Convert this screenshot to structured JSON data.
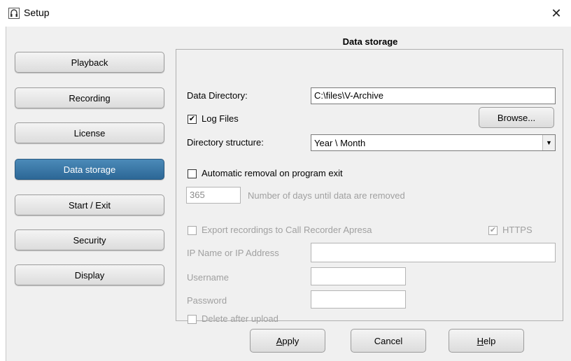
{
  "window": {
    "title": "Setup",
    "close_glyph": "✕"
  },
  "section_title": "Data storage",
  "nav": [
    {
      "label": "Playback",
      "active": false
    },
    {
      "label": "Recording",
      "active": false
    },
    {
      "label": "License",
      "active": false
    },
    {
      "label": "Data storage",
      "active": true
    },
    {
      "label": "Start / Exit",
      "active": false
    },
    {
      "label": "Security",
      "active": false
    },
    {
      "label": "Display",
      "active": false
    }
  ],
  "data_directory": {
    "label": "Data Directory:",
    "value": "C:\\files\\V-Archive"
  },
  "log_files": {
    "label": "Log Files",
    "checked": true
  },
  "browse_label": "Browse...",
  "directory_structure": {
    "label": "Directory structure:",
    "value": "Year \\ Month"
  },
  "auto_removal": {
    "label": "Automatic removal on program exit",
    "checked": false
  },
  "days": {
    "value": "365",
    "label": "Number of days until data are removed"
  },
  "export": {
    "label": "Export recordings to Call Recorder Apresa",
    "checked": false
  },
  "https": {
    "label": "HTTPS",
    "checked": true
  },
  "ip": {
    "label": "IP Name or IP Address",
    "value": ""
  },
  "username": {
    "label": "Username",
    "value": ""
  },
  "password": {
    "label": "Password",
    "value": ""
  },
  "delete_after_upload": {
    "label": "Delete after upload",
    "checked": false
  },
  "buttons": {
    "apply": {
      "mnemonic": "A",
      "rest": "pply"
    },
    "cancel": "Cancel",
    "help": {
      "mnemonic": "H",
      "rest": "elp"
    }
  },
  "colors": {
    "active_nav": "#2c6796",
    "disabled_text": "#a0a0a0"
  }
}
